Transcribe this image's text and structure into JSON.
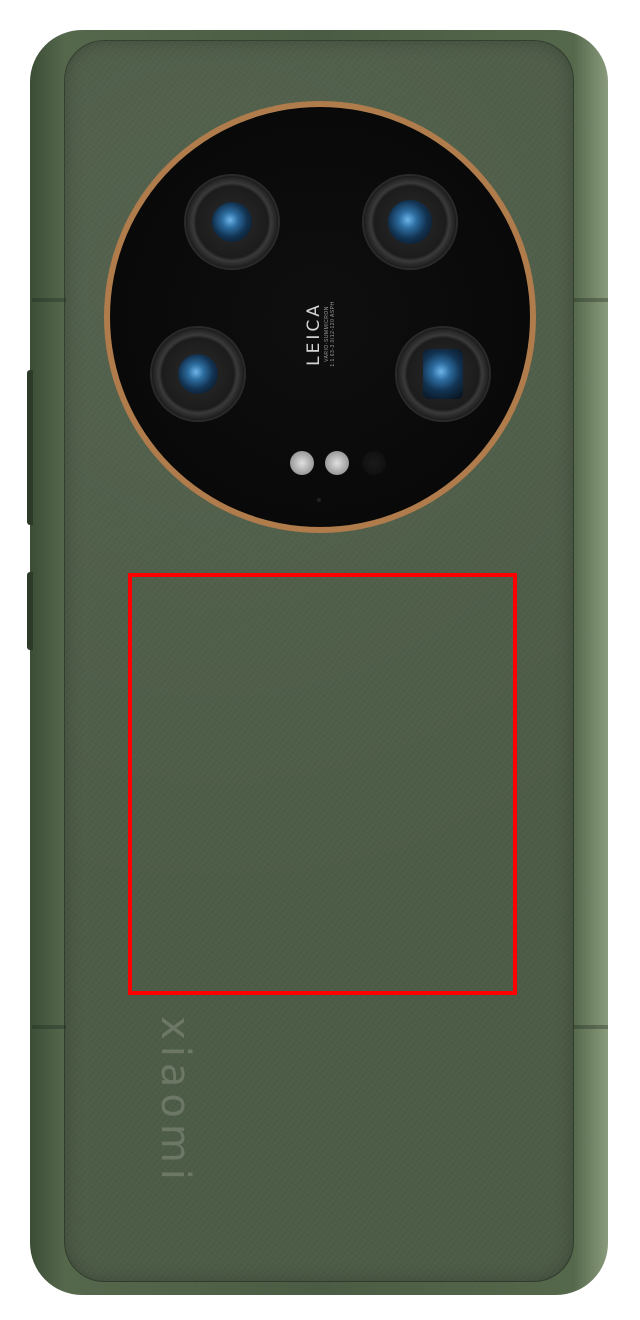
{
  "camera": {
    "brand": "LEICA",
    "lens_line1": "VARIO-SUMMICRON",
    "lens_line2": "1:1.63-3.0/12-120 ASPH"
  },
  "back": {
    "brand": "xiaomi"
  },
  "colors": {
    "body": "#4d5c47",
    "ring": "#c08a56",
    "highlight": "#ff0000"
  }
}
